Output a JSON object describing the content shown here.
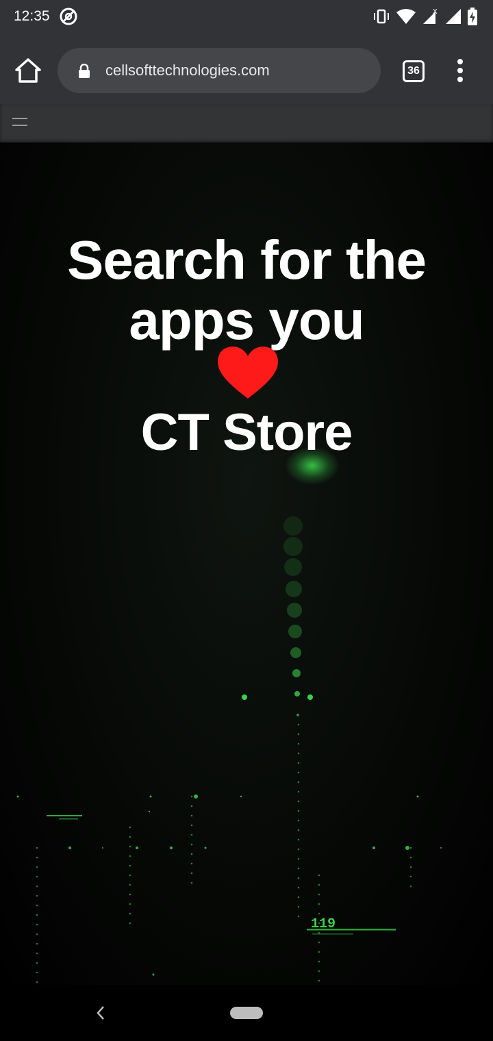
{
  "status_bar": {
    "time": "12:35",
    "icons": [
      "vibrate-icon",
      "wifi-icon",
      "signal-x-icon",
      "signal-icon",
      "battery-charging-icon"
    ]
  },
  "browser": {
    "url": "cellsofttechnologies.com",
    "tab_count": "36"
  },
  "hero": {
    "title_line1": "Search for the",
    "title_line2": "apps you",
    "subtitle": "CT Store",
    "heart_color": "#ff1a1a"
  },
  "matrix_art": {
    "readout": "119",
    "accent_color": "#3bd14a"
  },
  "colors": {
    "chrome_bg": "#323336",
    "url_pill": "#45464a",
    "site_header": "#333436"
  }
}
